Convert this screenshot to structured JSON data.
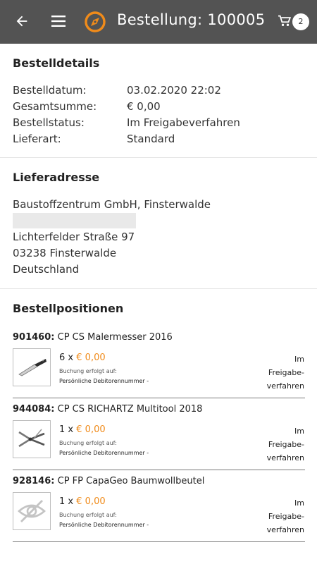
{
  "appbar": {
    "title": "Bestellung: 100005",
    "cart_count": "2",
    "icons": [
      "arrow-back-icon",
      "menu-icon",
      "compass-logo-icon",
      "shopping-cart-icon"
    ]
  },
  "details": {
    "heading": "Bestelldetails",
    "rows": [
      {
        "label": "Bestelldatum:",
        "value": "03.02.2020 22:02"
      },
      {
        "label": "Gesamtsumme:",
        "value": "€ 0,00"
      },
      {
        "label": "Bestellstatus:",
        "value": "Im Freigabeverfahren"
      },
      {
        "label": "Lieferart:",
        "value": "Standard"
      }
    ]
  },
  "address": {
    "heading": "Lieferadresse",
    "line1": "Baustoffzentrum GmbH, Finsterwalde",
    "line3": "Lichterfelder Straße 97",
    "line4": "03238 Finsterwalde",
    "line5": "Deutschland"
  },
  "positions": {
    "heading": "Bestellpositionen",
    "items": [
      {
        "number": "901460:",
        "name": "CP CS Malermesser 2016",
        "qty": "6",
        "x": "x",
        "price": "€ 0,00",
        "booking": "Buchung erfolgt auf:",
        "account": "Persönliche Debitorennummer -",
        "status1": "Im",
        "status2": "Freigabe-",
        "status3": "verfahren",
        "thumb": "knife-image"
      },
      {
        "number": "944084:",
        "name": "CP CS RICHARTZ Multitool 2018",
        "qty": "1",
        "x": "x",
        "price": "€ 0,00",
        "booking": "Buchung erfolgt auf:",
        "account": "Persönliche Debitorennummer -",
        "status1": "Im",
        "status2": "Freigabe-",
        "status3": "verfahren",
        "thumb": "multitool-image"
      },
      {
        "number": "928146:",
        "name": "CP FP CapaGeo Baumwollbeutel",
        "qty": "1",
        "x": "x",
        "price": "€ 0,00",
        "booking": "Buchung erfolgt auf:",
        "account": "Persönliche Debitorennummer -",
        "status1": "Im",
        "status2": "Freigabe-",
        "status3": "verfahren",
        "thumb": "no-image-icon"
      }
    ]
  },
  "colors": {
    "appbar": "#535353",
    "accent": "#f08b1a"
  }
}
